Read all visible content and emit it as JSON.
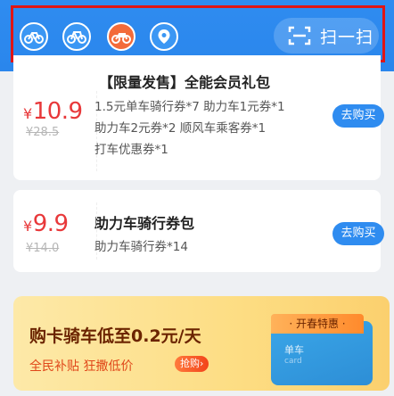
{
  "topbar": {
    "scan_label": "扫一扫",
    "icons": [
      "bike-icon",
      "bike-icon",
      "ebike-icon",
      "location-pin-icon"
    ],
    "colors": {
      "bar": "#2f8cf0",
      "highlight": "#e01515"
    }
  },
  "cards": [
    {
      "title": "【限量发售】全能会员礼包",
      "currency": "¥",
      "price": "10.9",
      "original_price": "¥28.5",
      "desc_lines": [
        "1.5元单车骑行券*7  助力车1元券*1",
        "助力车2元券*2  顺风车乘客券*1",
        "打车优惠券*1"
      ],
      "buy_label": "去购买"
    },
    {
      "title": "助力车骑行券包",
      "currency": "¥",
      "price": "9.9",
      "original_price": "¥14.0",
      "desc_lines": [
        "助力车骑行券*14"
      ],
      "buy_label": "去购买"
    }
  ],
  "promo": {
    "title": "购卡骑车低至0.2元/天",
    "subtitle": "全民补贴 狂撒低价",
    "badge": "抢购›",
    "card_tag": "· 开春特惠 ·",
    "card_line1": "单车",
    "card_line2": "card"
  }
}
